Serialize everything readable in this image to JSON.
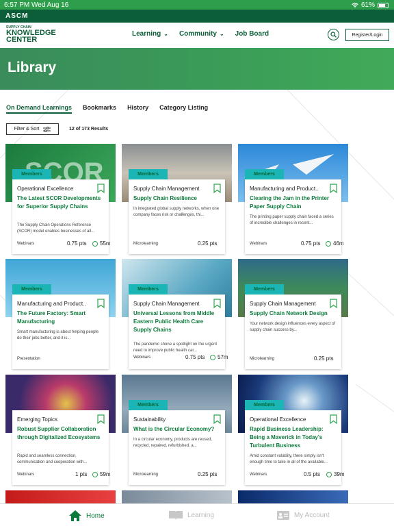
{
  "status_bar": {
    "time": "6:57 PM",
    "date": "Wed Aug 16",
    "battery": "61%"
  },
  "brand": {
    "ascm": "ASCM",
    "line1": "SUPPLY CHAIN",
    "line2": "KNOWLEDGE",
    "line3": "CENTER"
  },
  "nav": {
    "learning": "Learning",
    "community": "Community",
    "job_board": "Job Board",
    "register": "Register/Login"
  },
  "hero": {
    "title": "Library"
  },
  "tabs": [
    "On Demand Learnings",
    "Bookmarks",
    "History",
    "Category Listing"
  ],
  "filter": {
    "label": "Filter & Sort",
    "results": "12 of 173 Results"
  },
  "cards": [
    {
      "badge": "Members",
      "category": "Operational Excellence",
      "title": "The Latest SCOR Developments for Superior Supply Chains",
      "desc": "The Supply Chain Operations Reference (SCOR) model enables businesses of all...",
      "type": "Webinars",
      "pts": "0.75 pts",
      "duration": "55m",
      "thumb_text": "SCOR"
    },
    {
      "badge": "Members",
      "category": "Supply Chain Management",
      "title": "Supply Chain Resilience",
      "desc": "In integrated global supply networks, when one company faces risk or challenges, thi...",
      "type": "Microlearning",
      "pts": "0.25 pts",
      "duration": ""
    },
    {
      "badge": "Members",
      "category": "Manufacturing and Product..",
      "title": "Clearing the Jam in the Printer Paper Supply Chain",
      "desc": "The printing paper supply chain faced a series of incredible challenges in recent...",
      "type": "Webinars",
      "pts": "0.75 pts",
      "duration": "46m"
    },
    {
      "badge": "Members",
      "category": "Manufacturing and Product..",
      "title": "The Future Factory: Smart Manufacturing",
      "desc": "Smart manufacturing is about helping people do their jobs better, and it is...",
      "type": "Presentation",
      "pts": "",
      "duration": ""
    },
    {
      "badge": "Members",
      "category": "Supply Chain Management",
      "title": "Universal Lessons from Middle Eastern Public Health Care Supply Chains",
      "desc": "The pandemic shone a spotlight on the urgent need to improve public health car...",
      "type": "Webinars",
      "pts": "0.75 pts",
      "duration": "57m"
    },
    {
      "badge": "Members",
      "category": "Supply Chain Management",
      "title": "Supply Chain Network Design",
      "desc": "Your network design influences every aspect of supply chain success by...",
      "type": "Microlearning",
      "pts": "0.25 pts",
      "duration": ""
    },
    {
      "badge": "",
      "category": "Emerging Topics",
      "title": "Robust Supplier Collaboration through Digitalized Ecosystems",
      "desc": "Rapid and seamless connection, communication and cooperation with...",
      "type": "Webinars",
      "pts": "1 pts",
      "duration": "59m"
    },
    {
      "badge": "Members",
      "category": "Sustainability",
      "title": "What is the Circular Economy?",
      "desc": "In a circular economy, products are reused, recycled, repaired, refurbished, a...",
      "type": "Microlearning",
      "pts": "0.25 pts",
      "duration": ""
    },
    {
      "badge": "Members",
      "category": "Operational Excellence",
      "title": "Rapid Business Leadership: Being a Maverick in Today's Turbulent Business",
      "desc": "Amid constant volatility, there simply isn't enough time to take in all of the available...",
      "type": "Webinars",
      "pts": "0.5 pts",
      "duration": "39m"
    }
  ],
  "bottom_nav": {
    "home": "Home",
    "learning": "Learning",
    "account": "My Account"
  },
  "colors": {
    "brand_green": "#0b5e37",
    "title_green": "#0b7a3b",
    "badge_teal": "#1bb5b5"
  }
}
